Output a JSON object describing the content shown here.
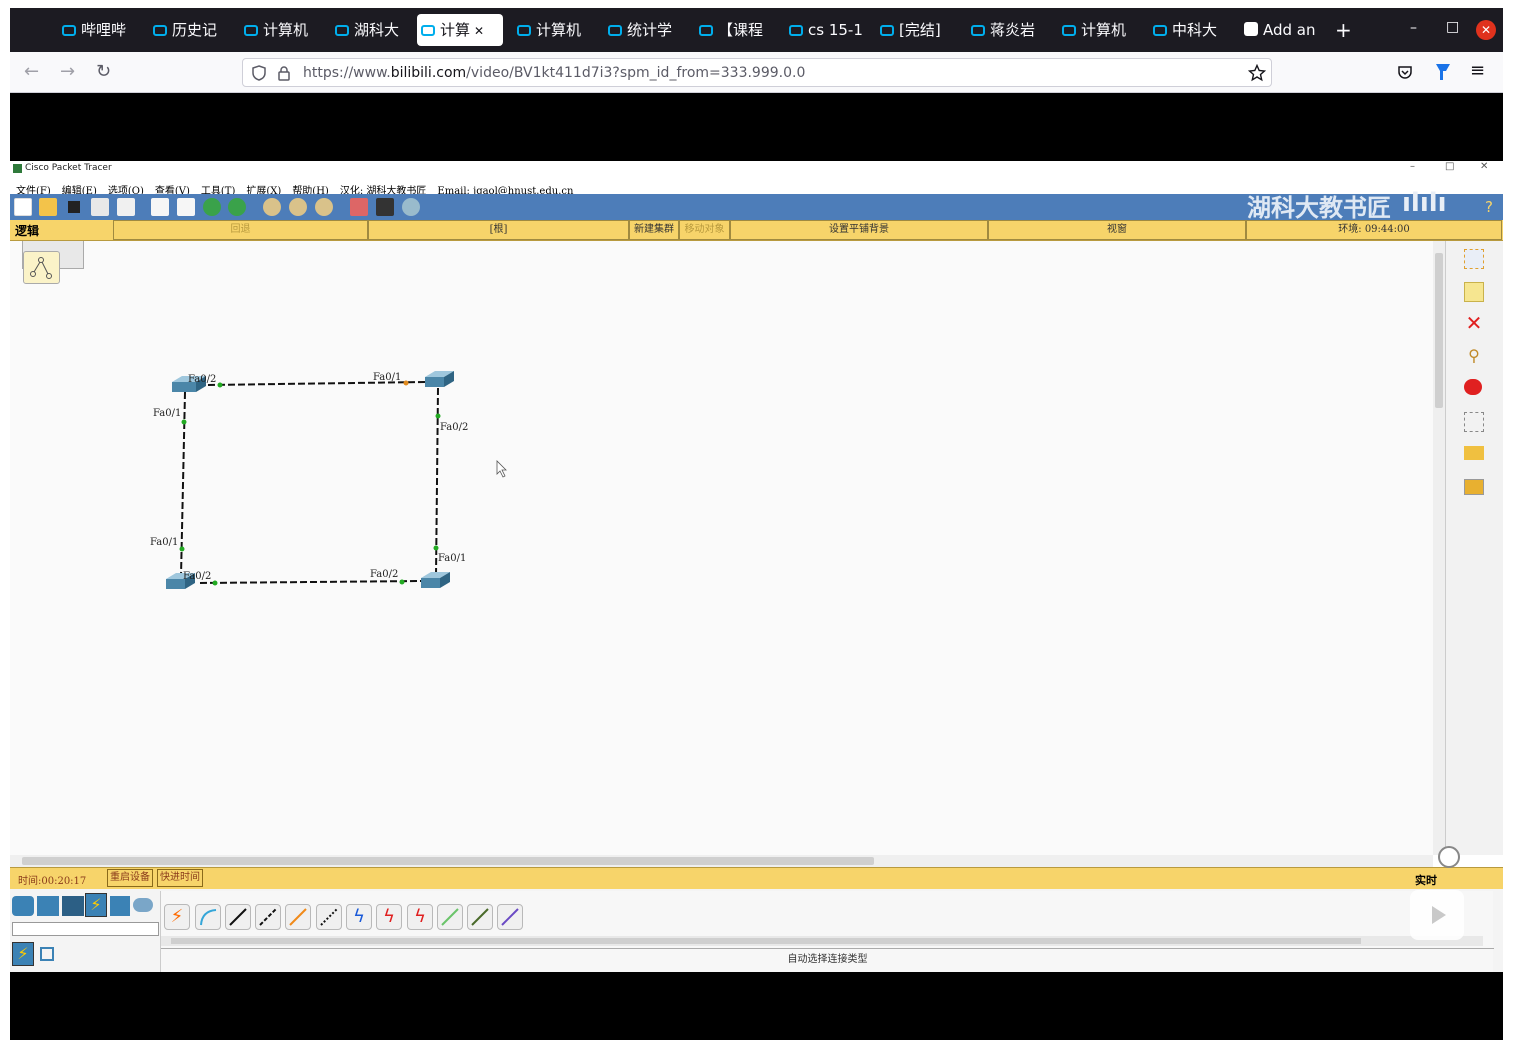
{
  "browser": {
    "tabs": [
      {
        "label": "哔哩哔",
        "active": false
      },
      {
        "label": "历史记",
        "active": false
      },
      {
        "label": "计算机",
        "active": false
      },
      {
        "label": "湖科大",
        "active": false
      },
      {
        "label": "计算",
        "active": true
      },
      {
        "label": "计算机",
        "active": false
      },
      {
        "label": "统计学",
        "active": false
      },
      {
        "label": "【课程",
        "active": false
      },
      {
        "label": "cs 15-1",
        "active": false
      },
      {
        "label": "[完结]",
        "active": false
      },
      {
        "label": "蒋炎岩",
        "active": false
      },
      {
        "label": "计算机",
        "active": false
      },
      {
        "label": "中科大",
        "active": false
      },
      {
        "label": "Add an",
        "active": false
      }
    ],
    "new_tab": "+",
    "url_prefix": "https://www.",
    "url_domain": "bilibili.com",
    "url_path": "/video/BV1kt411d7i3?spm_id_from=333.999.0.0",
    "window_controls": {
      "minimize": "–",
      "maximize": "□",
      "close": "✕"
    }
  },
  "packet_tracer": {
    "window_title": "Cisco Packet Tracer",
    "menu": [
      "文件(F)",
      "编辑(E)",
      "选项(O)",
      "查看(V)",
      "工具(T)",
      "扩展(X)",
      "帮助(H)",
      "汉化: 湖科大教书匠",
      "Email: jgaol@hnust.edu.cn"
    ],
    "watermark": "湖科大教书匠",
    "help": "?",
    "logic_label": "逻辑",
    "bar_cells": [
      "回退",
      "[根]",
      "新建集群",
      "移动对象",
      "设置平铺背景",
      "视窗",
      "环境: 09:44:00"
    ],
    "time_label": "时间:00:20:17",
    "power_cycle": "重启设备",
    "fast_forward": "快进时间",
    "realtime": "实时",
    "connection_hint": "自动选择连接类型"
  },
  "topology": {
    "switches": [
      {
        "id": "sw-top-left"
      },
      {
        "id": "sw-top-right"
      },
      {
        "id": "sw-bottom-left"
      },
      {
        "id": "sw-bottom-right"
      }
    ],
    "ports": [
      "Fa0/2",
      "Fa0/1",
      "Fa0/1",
      "Fa0/2",
      "Fa0/1",
      "Fa0/2",
      "Fa0/2",
      "Fa0/1"
    ],
    "link_status_colors": {
      "up": "#22aa22",
      "blocking": "#e08a1e"
    }
  }
}
